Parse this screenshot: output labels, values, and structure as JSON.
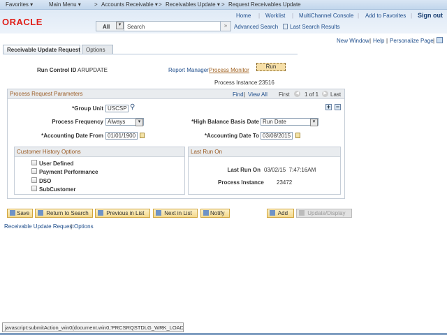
{
  "nav": {
    "favorites": "Favorites ▾",
    "main_menu": "Main Menu ▾",
    "crumbs": [
      "Accounts Receivable ▾",
      "Receivables Update ▾",
      "Request Receivables Update"
    ],
    "sep": ">"
  },
  "header": {
    "logo": "ORACLE",
    "links": [
      "Home",
      "Worklist",
      "MultiChannel Console",
      "Add to Favorites"
    ],
    "sign_out": "Sign out",
    "search_scope": "All",
    "search_placeholder": "Search",
    "search_go": "»",
    "advanced_search": "Advanced Search",
    "last_search": "Last Search Results"
  },
  "utility": {
    "new_window": "New Window",
    "help": "Help",
    "personalize": "Personalize Page"
  },
  "tabs": [
    "Receivable Update Request",
    "Options"
  ],
  "run": {
    "run_control_label": "Run Control ID",
    "run_control_value": "ARUPDATE",
    "report_manager": "Report Manager",
    "process_monitor": "Process Monitor",
    "run_button": "Run",
    "process_instance": "Process Instance:23516"
  },
  "params": {
    "title": "Process Request Parameters",
    "find": "Find",
    "view_all": "View All",
    "first": "First",
    "count": "1 of 1",
    "last": "Last",
    "group_unit_label": "*Group Unit",
    "group_unit": "USCSP",
    "freq_label": "Process Frequency",
    "freq": "Always",
    "hb_label": "*High Balance Basis Date",
    "hb": "Run Date",
    "from_label": "*Accounting Date From",
    "from": "01/01/1900",
    "to_label": "*Accounting Date To",
    "to": "03/08/2015"
  },
  "history": {
    "title": "Customer History Options",
    "options": [
      "User Defined",
      "Payment Performance",
      "DSO",
      "SubCustomer"
    ]
  },
  "lastrun": {
    "title": "Last Run On",
    "on_label": "Last Run On",
    "on_value": "03/02/15  7:47:16AM",
    "pi_label": "Process Instance",
    "pi_value": "23472"
  },
  "buttons": {
    "save": "Save",
    "return": "Return to Search",
    "prev": "Previous in List",
    "next": "Next in List",
    "notify": "Notify",
    "add": "Add",
    "update": "Update/Display"
  },
  "footer": {
    "link1": "Receivable Update Request",
    "link2": "Options"
  },
  "status": "javascript:submitAction_win0(document.win0,'PRCSRQSTDLG_WRK_LOAD..."
}
